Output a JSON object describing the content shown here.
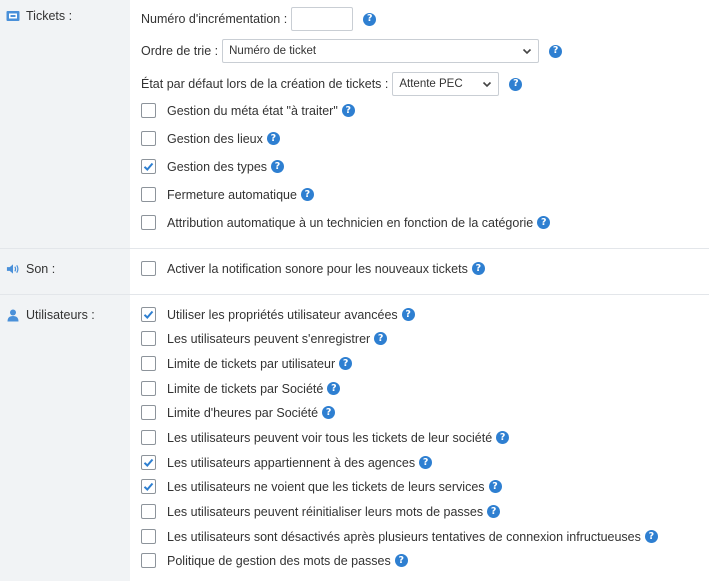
{
  "sections": {
    "tickets": {
      "label": "Tickets :",
      "icon": "ticket-icon"
    },
    "son": {
      "label": "Son :",
      "icon": "volume-icon"
    },
    "utilisateurs": {
      "label": "Utilisateurs :",
      "icon": "user-icon"
    }
  },
  "tickets": {
    "increment_label": "Numéro d'incrémentation :",
    "increment_value": "",
    "sort_label": "Ordre de trie :",
    "sort_value": "Numéro de ticket",
    "default_state_label": "État par défaut lors de la création de tickets :",
    "default_state_value": "Attente PEC",
    "options": [
      {
        "label": "Gestion du méta état \"à traiter\"",
        "checked": false
      },
      {
        "label": "Gestion des lieux",
        "checked": false
      },
      {
        "label": "Gestion des types",
        "checked": true
      },
      {
        "label": "Fermeture automatique",
        "checked": false
      },
      {
        "label": "Attribution automatique à un technicien en fonction de la catégorie",
        "checked": false
      }
    ]
  },
  "son": {
    "options": [
      {
        "label": "Activer la notification sonore pour les nouveaux tickets",
        "checked": false
      }
    ]
  },
  "utilisateurs": {
    "options": [
      {
        "label": "Utiliser les propriétés utilisateur avancées",
        "checked": true
      },
      {
        "label": "Les utilisateurs peuvent s'enregistrer",
        "checked": false
      },
      {
        "label": "Limite de tickets par utilisateur",
        "checked": false
      },
      {
        "label": "Limite de tickets par Société",
        "checked": false
      },
      {
        "label": "Limite d'heures par Société",
        "checked": false
      },
      {
        "label": "Les utilisateurs peuvent voir tous les tickets de leur société",
        "checked": false
      },
      {
        "label": "Les utilisateurs appartiennent à des agences",
        "checked": true
      },
      {
        "label": "Les utilisateurs ne voient que les tickets de leurs services",
        "checked": true
      },
      {
        "label": "Les utilisateurs peuvent réinitialiser leurs mots de passes",
        "checked": false
      },
      {
        "label": "Les utilisateurs sont désactivés après plusieurs tentatives de connexion infructueuses",
        "checked": false
      },
      {
        "label": "Politique de gestion des mots de passes",
        "checked": false
      }
    ]
  },
  "help_glyph": "?",
  "colors": {
    "accent": "#2e7fd1",
    "check": "#2e7fd1",
    "sidebar_bg": "#f1f3f5"
  }
}
